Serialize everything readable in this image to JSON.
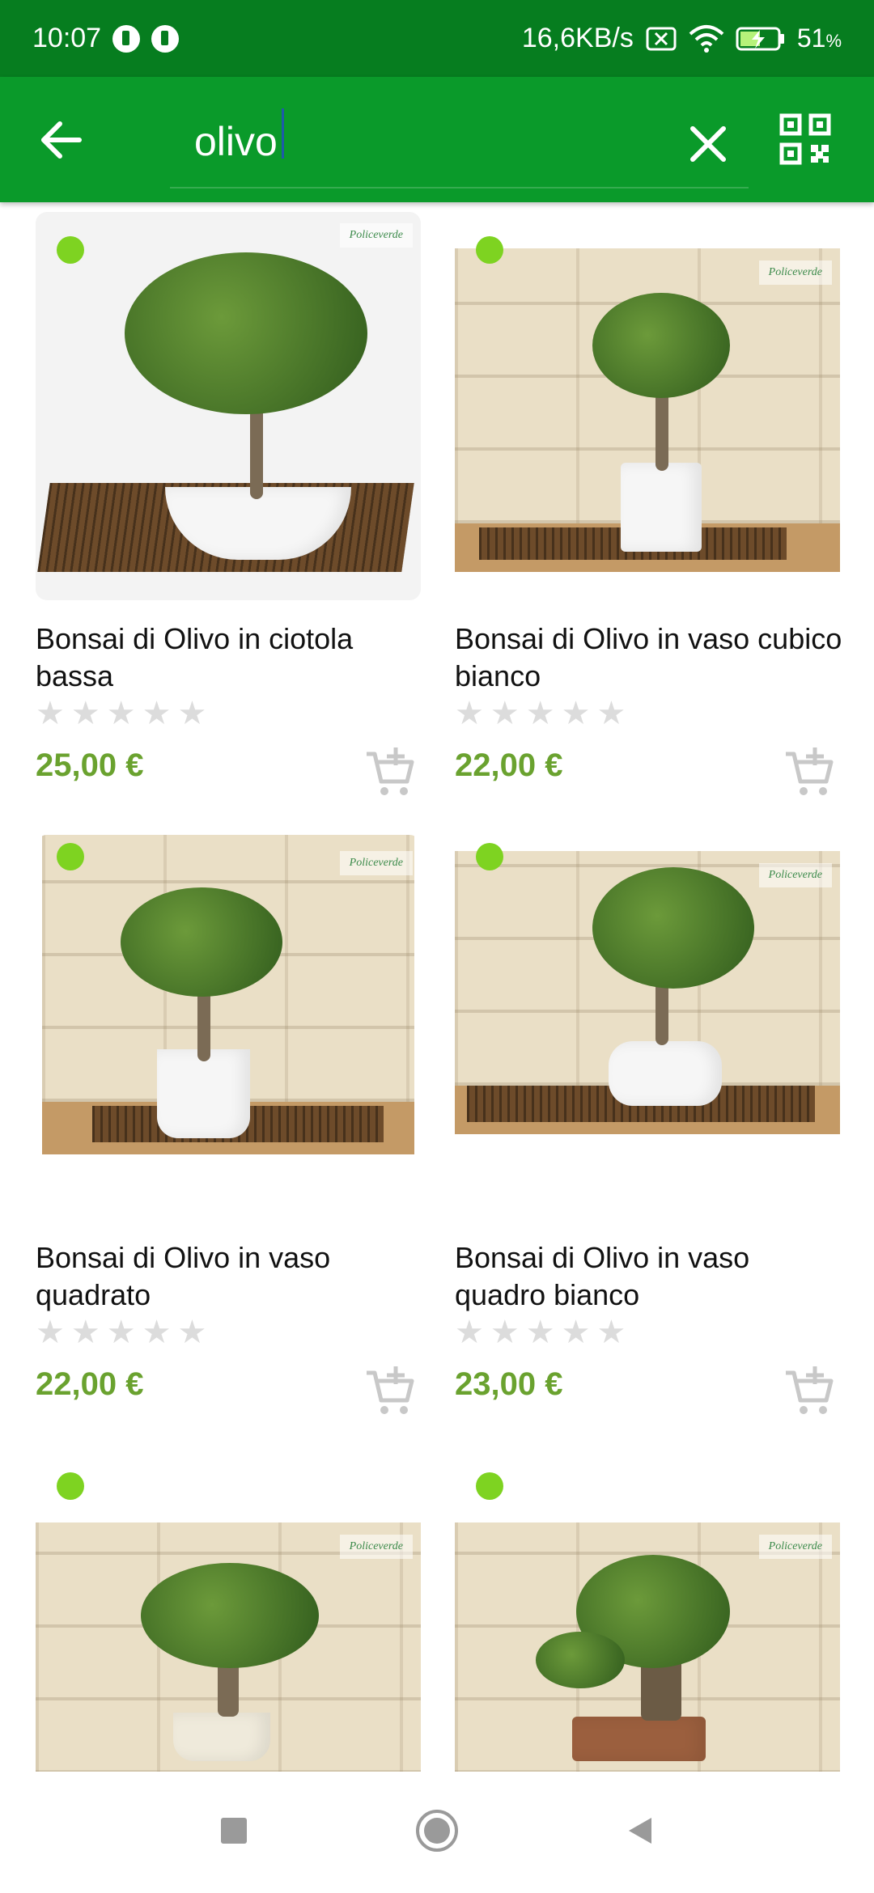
{
  "status_bar": {
    "time": "10:07",
    "net_speed": "16,6KB/s",
    "battery_percent": "51",
    "battery_unit": "%"
  },
  "app_bar": {
    "search_value": "olivo",
    "icons": [
      "back-arrow-icon",
      "clear-icon",
      "qr-scan-icon"
    ]
  },
  "products": [
    {
      "title": "Bonsai di Olivo in ciotola bassa",
      "price": "25,00 €",
      "rating": 0,
      "available": true
    },
    {
      "title": "Bonsai di Olivo in vaso cubico bianco",
      "price": "22,00 €",
      "rating": 0,
      "available": true
    },
    {
      "title": "Bonsai di Olivo in vaso quadrato",
      "price": "22,00 €",
      "rating": 0,
      "available": true
    },
    {
      "title": "Bonsai di Olivo in vaso quadro bianco",
      "price": "23,00 €",
      "rating": 0,
      "available": true
    },
    {
      "title": "",
      "price": "",
      "rating": 0,
      "available": true
    },
    {
      "title": "",
      "price": "",
      "rating": 0,
      "available": true
    }
  ],
  "colors": {
    "status_bar": "#067d1f",
    "app_bar": "#0a9a2a",
    "price": "#6aa22f",
    "availability_dot": "#7ed321",
    "star_empty": "#dcdcdc"
  }
}
